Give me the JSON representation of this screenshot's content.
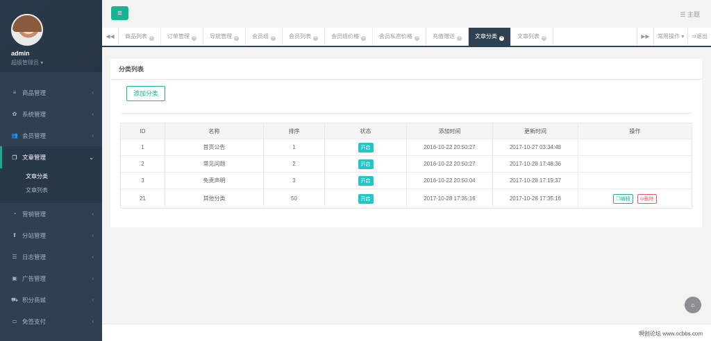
{
  "profile": {
    "name": "admin",
    "role": "超级管理员 ▾"
  },
  "sidebar": {
    "items": [
      {
        "label": "商品管理",
        "icon": "≡",
        "icon_name": "list-icon"
      },
      {
        "label": "系统管理",
        "icon": "✿",
        "icon_name": "gear-icon"
      },
      {
        "label": "会员管理",
        "icon": "👥",
        "icon_name": "users-icon"
      },
      {
        "label": "文章管理",
        "icon": "❐",
        "icon_name": "copy-icon"
      },
      {
        "label": "营销管理",
        "icon": "◔",
        "icon_name": "pie-chart-icon"
      },
      {
        "label": "分站管理",
        "icon": "⬆",
        "icon_name": "upload-icon"
      },
      {
        "label": "日志管理",
        "icon": "☰",
        "icon_name": "log-icon"
      },
      {
        "label": "广告管理",
        "icon": "▣",
        "icon_name": "image-icon"
      },
      {
        "label": "积分商城",
        "icon": "⛟",
        "icon_name": "cart-icon"
      },
      {
        "label": "免签支付",
        "icon": "▭",
        "icon_name": "credit-card-icon"
      }
    ],
    "sub": [
      "文章分类",
      "文章列表"
    ],
    "chevron": "‹",
    "chevron_open": "⌄"
  },
  "topbar": {
    "menu_icon": "≡",
    "theme_label": "主题",
    "theme_icon": "☰"
  },
  "tabs": {
    "prev": "◀◀",
    "next": "▶▶",
    "items": [
      "商品列表",
      "订单管理",
      "导航管理",
      "会员组",
      "会员列表",
      "会员组价格",
      "会员私密价格",
      "充值赠送",
      "文章分类",
      "文章列表"
    ],
    "active_index": 8,
    "close": "×",
    "common_ops": "常用操作 ▾",
    "logout": "退出",
    "logout_icon": "⇒"
  },
  "panel": {
    "title": "分类列表",
    "add_button": "添加分类",
    "columns": [
      "ID",
      "名称",
      "排序",
      "状态",
      "添加时间",
      "更新时间",
      "操作"
    ],
    "rows": [
      {
        "id": "1",
        "name": "首页公告",
        "sort": "1",
        "status": "开启",
        "added": "2016-10-22 20:50:27",
        "updated": "2017-10-27 03:34:48"
      },
      {
        "id": "2",
        "name": "常见问题",
        "sort": "2",
        "status": "开启",
        "added": "2016-10-22 20:50:27",
        "updated": "2017-10-28 17:48:36"
      },
      {
        "id": "3",
        "name": "免责声明",
        "sort": "3",
        "status": "开启",
        "added": "2016-10-22 20:50:04",
        "updated": "2017-10-28 17:19:37"
      },
      {
        "id": "21",
        "name": "其他分类",
        "sort": "50",
        "status": "开启",
        "added": "2017-10-28 17:35:16",
        "updated": "2017-10-28 17:35:16"
      }
    ],
    "edit_label": "编辑",
    "delete_label": "删除",
    "edit_icon": "❐",
    "delete_icon": "⊜"
  },
  "footer": {
    "text": "啊创论坛 www.ocbbs.com"
  },
  "home_icon": "⌂",
  "colors": {
    "accent": "#1ab394",
    "sidebar": "#2f4050",
    "badge": "#23c6c8",
    "danger": "#ed5565"
  }
}
